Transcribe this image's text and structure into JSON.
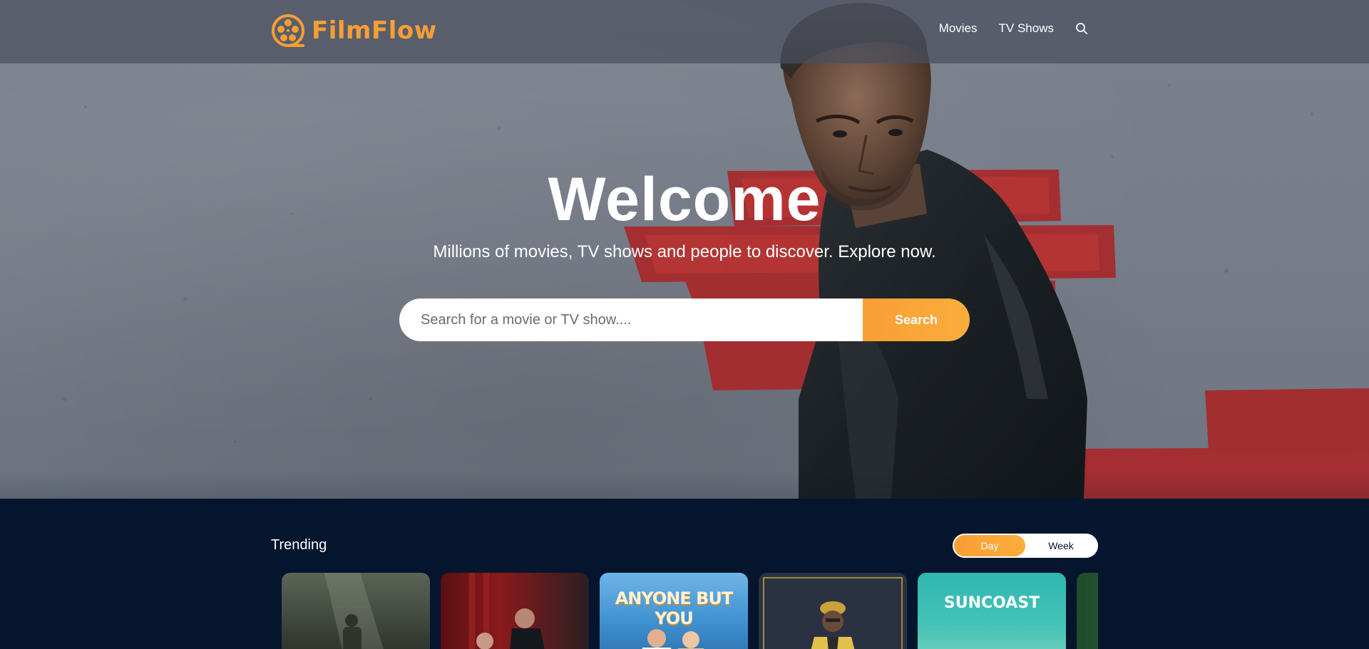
{
  "brand": {
    "name": "FilmFlow",
    "accent": "#f89e34",
    "background": "#04152d"
  },
  "nav": {
    "items": [
      "Movies",
      "TV Shows"
    ],
    "search_icon": "search-icon"
  },
  "hero": {
    "title": "Welcome",
    "subtitle": "Millions of movies, TV shows and people to discover. Explore now."
  },
  "search": {
    "placeholder": "Search for a movie or TV show....",
    "value": "",
    "button_label": "Search"
  },
  "trending": {
    "title": "Trending",
    "toggle": {
      "options": [
        "Day",
        "Week"
      ],
      "selected": "Day"
    },
    "cards": [
      {
        "title": ""
      },
      {
        "title": ""
      },
      {
        "title": "ANYONE BUT YOU"
      },
      {
        "title": ""
      },
      {
        "title": "SUNCOAST"
      },
      {
        "title": ""
      }
    ]
  }
}
